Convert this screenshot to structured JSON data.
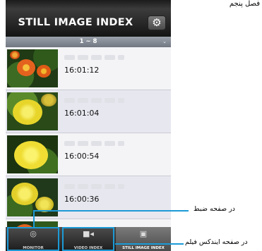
{
  "page_label": "فصل پنجم",
  "header": {
    "title": "STILL IMAGE INDEX",
    "settings_icon": "gear-icon"
  },
  "range": {
    "label": "1 ~ 8",
    "arrow": "⌄"
  },
  "rows": [
    {
      "time": "16:01:12"
    },
    {
      "time": "16:01:04"
    },
    {
      "time": "16:00:54"
    },
    {
      "time": "16:00:36"
    }
  ],
  "tabs": [
    {
      "label": "MONITOR",
      "icon": "camera-lens-icon"
    },
    {
      "label": "VIDEO INDEX",
      "icon": "video-camera-icon"
    },
    {
      "label": "STILL IMAGE INDEX",
      "icon": "camera-icon"
    }
  ],
  "callouts": {
    "record_page": "در صفحه ضبط",
    "video_index_page": "در صفحه ایندکس فیلم"
  },
  "accent_color": "#1c9ad6"
}
